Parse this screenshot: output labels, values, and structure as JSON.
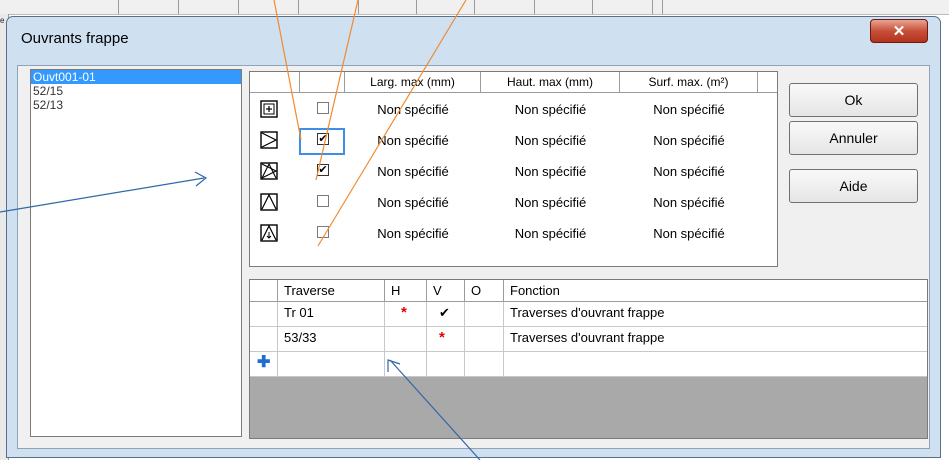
{
  "background": {
    "corner_text": "e"
  },
  "dialog": {
    "title": "Ouvrants frappe",
    "close_glyph": "✕"
  },
  "list": {
    "items": [
      {
        "label": "Ouvt001-01",
        "selected": true
      },
      {
        "label": "52/15",
        "selected": false
      },
      {
        "label": "52/13",
        "selected": false
      }
    ]
  },
  "opening_grid": {
    "headers": {
      "larg": "Larg. max (mm)",
      "haut": "Haut. max (mm)",
      "surf": "Surf. max. (m²)"
    },
    "rows": [
      {
        "icon": "fixed-frame-icon",
        "checked": false,
        "larg": "Non spécifié",
        "haut": "Non spécifié",
        "surf": "Non spécifié"
      },
      {
        "icon": "side-hung-right-icon",
        "checked": true,
        "larg": "Non spécifié",
        "haut": "Non spécifié",
        "surf": "Non spécifié"
      },
      {
        "icon": "tilt-turn-icon",
        "checked": true,
        "larg": "Non spécifié",
        "haut": "Non spécifié",
        "surf": "Non spécifié"
      },
      {
        "icon": "bottom-hung-icon",
        "checked": false,
        "larg": "Non spécifié",
        "haut": "Non spécifié",
        "surf": "Non spécifié"
      },
      {
        "icon": "bottom-hung-arrow-icon",
        "checked": false,
        "larg": "Non spécifié",
        "haut": "Non spécifié",
        "surf": "Non spécifié"
      }
    ]
  },
  "traverse_grid": {
    "headers": {
      "traverse": "Traverse",
      "h": "H",
      "v": "V",
      "o": "O",
      "fonction": "Fonction"
    },
    "rows": [
      {
        "traverse": "Tr 01",
        "h": "*",
        "v": "✔",
        "o": "",
        "fonction": "Traverses d'ouvrant frappe"
      },
      {
        "traverse": "53/33",
        "h": "",
        "v": "*",
        "o": "",
        "fonction": "Traverses d'ouvrant frappe"
      }
    ],
    "new_row_glyph": "✚"
  },
  "buttons": {
    "ok": "Ok",
    "cancel": "Annuler",
    "help": "Aide"
  },
  "colors": {
    "selection": "#3399ff",
    "focus": "#3c8ee6",
    "annotation_orange": "#f28a30",
    "annotation_blue": "#2f68a8",
    "required_star": "#e00000",
    "close_button": "#c7503a"
  }
}
